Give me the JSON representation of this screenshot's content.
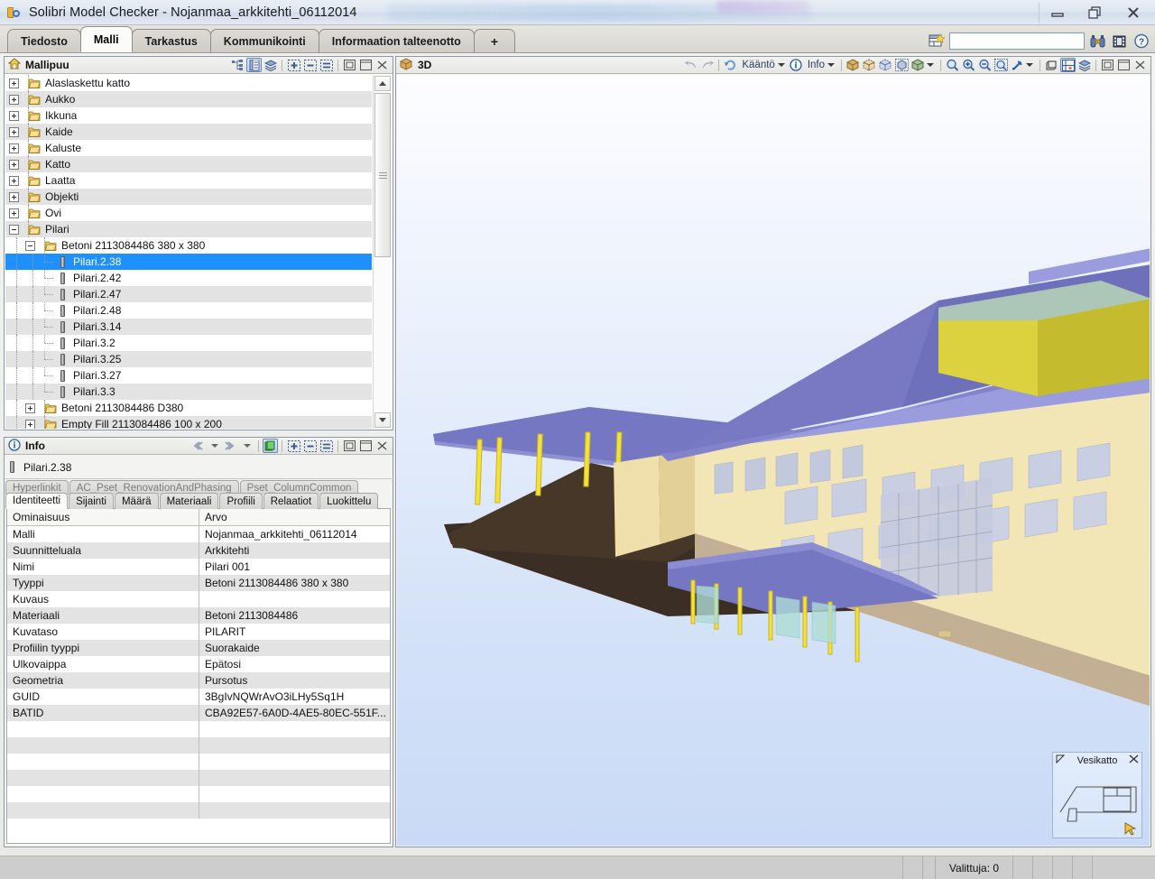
{
  "window": {
    "title": "Solibri Model Checker - Nojanmaa_arkkitehti_06112014",
    "app_icon": "keys-icon",
    "minimize": "minimize-icon",
    "restore": "restore-icon",
    "close": "close-icon"
  },
  "main_tabs": [
    {
      "label": "Tiedosto",
      "active": false
    },
    {
      "label": "Malli",
      "active": true
    },
    {
      "label": "Tarkastus",
      "active": false
    },
    {
      "label": "Kommunikointi",
      "active": false
    },
    {
      "label": "Informaation talteenotto",
      "active": false
    },
    {
      "label": "+",
      "active": false
    }
  ],
  "tabbar_right": {
    "new_layout_icon": "new-layout-icon",
    "search_value": "",
    "search_placeholder": "",
    "find_icon": "binoculars-icon",
    "film_icon": "filmstrip-icon",
    "help_icon": "help-icon"
  },
  "tree_panel": {
    "icon": "house-icon",
    "title": "Mallipuu",
    "tools": [
      {
        "name": "hierarchy-icon",
        "pressed": false
      },
      {
        "name": "grouping-icon",
        "pressed": true
      },
      {
        "name": "layers-icon",
        "pressed": false
      },
      {
        "name": "expand-all-icon",
        "pressed": false
      },
      {
        "name": "collapse-all-icon",
        "pressed": false
      },
      {
        "name": "list-view-icon",
        "pressed": false
      },
      {
        "name": "restore-panel-icon",
        "pressed": false
      },
      {
        "name": "maximize-panel-icon",
        "pressed": false
      },
      {
        "name": "close-panel-icon",
        "pressed": false
      }
    ],
    "rows": [
      {
        "label": "Alaslaskettu katto",
        "depth": 0,
        "kind": "folder",
        "state": "collapsed",
        "selected": false
      },
      {
        "label": "Aukko",
        "depth": 0,
        "kind": "folder",
        "state": "collapsed",
        "selected": false
      },
      {
        "label": "Ikkuna",
        "depth": 0,
        "kind": "folder",
        "state": "collapsed",
        "selected": false
      },
      {
        "label": "Kaide",
        "depth": 0,
        "kind": "folder",
        "state": "collapsed",
        "selected": false
      },
      {
        "label": "Kaluste",
        "depth": 0,
        "kind": "folder",
        "state": "collapsed",
        "selected": false
      },
      {
        "label": "Katto",
        "depth": 0,
        "kind": "folder",
        "state": "collapsed",
        "selected": false
      },
      {
        "label": "Laatta",
        "depth": 0,
        "kind": "folder",
        "state": "collapsed",
        "selected": false
      },
      {
        "label": "Objekti",
        "depth": 0,
        "kind": "folder",
        "state": "collapsed",
        "selected": false
      },
      {
        "label": "Ovi",
        "depth": 0,
        "kind": "folder",
        "state": "collapsed",
        "selected": false
      },
      {
        "label": "Pilari",
        "depth": 0,
        "kind": "folder",
        "state": "expanded",
        "selected": false
      },
      {
        "label": "Betoni 2113084486 380 x 380",
        "depth": 1,
        "kind": "folder",
        "state": "expanded",
        "selected": false
      },
      {
        "label": "Pilari.2.38",
        "depth": 2,
        "kind": "column",
        "state": "leaf",
        "selected": true
      },
      {
        "label": "Pilari.2.42",
        "depth": 2,
        "kind": "column",
        "state": "leaf",
        "selected": false
      },
      {
        "label": "Pilari.2.47",
        "depth": 2,
        "kind": "column",
        "state": "leaf",
        "selected": false
      },
      {
        "label": "Pilari.2.48",
        "depth": 2,
        "kind": "column",
        "state": "leaf",
        "selected": false
      },
      {
        "label": "Pilari.3.14",
        "depth": 2,
        "kind": "column",
        "state": "leaf",
        "selected": false
      },
      {
        "label": "Pilari.3.2",
        "depth": 2,
        "kind": "column",
        "state": "leaf",
        "selected": false
      },
      {
        "label": "Pilari.3.25",
        "depth": 2,
        "kind": "column",
        "state": "leaf",
        "selected": false
      },
      {
        "label": "Pilari.3.27",
        "depth": 2,
        "kind": "column",
        "state": "leaf",
        "selected": false
      },
      {
        "label": "Pilari.3.3",
        "depth": 2,
        "kind": "column",
        "state": "leaf",
        "selected": false
      },
      {
        "label": "Betoni 2113084486 D380",
        "depth": 1,
        "kind": "folder",
        "state": "collapsed",
        "selected": false
      },
      {
        "label": "Empty Fill 2113084486 100 x 200",
        "depth": 1,
        "kind": "folder",
        "state": "collapsed",
        "selected": false
      }
    ]
  },
  "info_panel": {
    "icon": "info-icon",
    "title": "Info",
    "nav": {
      "back_icon": "back-arrow-icon",
      "back_menu_icon": "chevron-down-icon",
      "forward_icon": "forward-arrow-icon",
      "forward_menu_icon": "chevron-down-icon",
      "sync_icon": "sync-selection-icon",
      "expand_all_icon": "expand-all-icon",
      "collapse_all_icon": "collapse-all-icon",
      "list_view_icon": "list-view-icon",
      "restore_icon": "restore-panel-icon",
      "maximize_icon": "maximize-panel-icon",
      "close_icon": "close-panel-icon"
    },
    "selected_object": "Pilari.2.38",
    "selected_object_icon": "column-icon",
    "tabs_top": [
      "Hyperlinkit",
      "AC_Pset_RenovationAndPhasing",
      "Pset_ColumnCommon"
    ],
    "tabs_bottom": [
      {
        "label": "Identiteetti",
        "active": true
      },
      {
        "label": "Sijainti",
        "active": false
      },
      {
        "label": "Määrä",
        "active": false
      },
      {
        "label": "Materiaali",
        "active": false
      },
      {
        "label": "Profiili",
        "active": false
      },
      {
        "label": "Relaatiot",
        "active": false
      },
      {
        "label": "Luokittelu",
        "active": false
      }
    ],
    "table": {
      "headers": [
        "Ominaisuus",
        "Arvo"
      ],
      "rows": [
        [
          "Malli",
          "Nojanmaa_arkkitehti_06112014"
        ],
        [
          "Suunnitteluala",
          "Arkkitehti"
        ],
        [
          "Nimi",
          "Pilari 001"
        ],
        [
          "Tyyppi",
          "Betoni 2113084486 380 x 380"
        ],
        [
          "Kuvaus",
          ""
        ],
        [
          "Materiaali",
          "Betoni 2113084486"
        ],
        [
          "Kuvataso",
          "PILARIT"
        ],
        [
          "Profiilin tyyppi",
          "Suorakaide"
        ],
        [
          "Ulkovaippa",
          "Epätosi"
        ],
        [
          "Geometria",
          "Pursotus"
        ],
        [
          "GUID",
          "3BgIvNQWrAvO3iLHy5Sq1H"
        ],
        [
          "BATID",
          "CBA92E57-6A0D-4AE5-80EC-551F..."
        ]
      ]
    }
  },
  "view3d": {
    "icon": "cube-icon",
    "title": "3D",
    "toolbar": {
      "undo_icon": "undo-arrow-icon",
      "redo_icon": "redo-arrow-icon",
      "rotate_icon": "rotate-icon",
      "rotate_label": "Kääntö",
      "rotate_caret": "chevron-down-icon",
      "info_icon": "info-icon",
      "info_label": "Info",
      "info_caret": "chevron-down-icon",
      "solid_icon": "solid-cube-icon",
      "transparent_icon": "transparent-cube-icon",
      "wireframe_icon": "wireframe-cube-icon",
      "hidden_icon": "hidden-cube-icon",
      "shading_icon": "shaded-cube-icon",
      "shading_caret": "chevron-down-icon",
      "zoom_fit_icon": "zoom-fit-icon",
      "zoom_in_icon": "zoom-in-icon",
      "zoom_out_icon": "zoom-out-icon",
      "zoom_area_icon": "zoom-area-icon",
      "pick_icon": "pick-arrow-icon",
      "pick_caret": "chevron-down-icon",
      "box_icon": "bounding-box-icon",
      "section_icon": "section-plane-icon",
      "layers_icon": "layers-icon",
      "restore_icon": "restore-panel-icon",
      "maximize_icon": "maximize-panel-icon",
      "close_icon": "close-panel-icon"
    },
    "mini_preview": {
      "title": "Vesikatto",
      "pin_icon": "pin-icon",
      "close_icon": "close-panel-icon",
      "cursor_icon": "hand-cursor-icon"
    },
    "colors": {
      "roof": "#7b7cc4",
      "roof_light": "#9a9cd9",
      "wall": "#f2e4b0",
      "wall_shade": "#e4d39a",
      "penthouse": "#ddd23c",
      "penthouse_top": "#9ec4bd",
      "column": "#f3e23a",
      "glass": "#c6ccdf",
      "ground_shadow": "#3c2f24",
      "plinth": "#bfae98",
      "background_top": "#fdfdff",
      "background_bottom": "#c9daf6"
    }
  },
  "statusbar": {
    "selection_label": "Valittuja: 0"
  }
}
